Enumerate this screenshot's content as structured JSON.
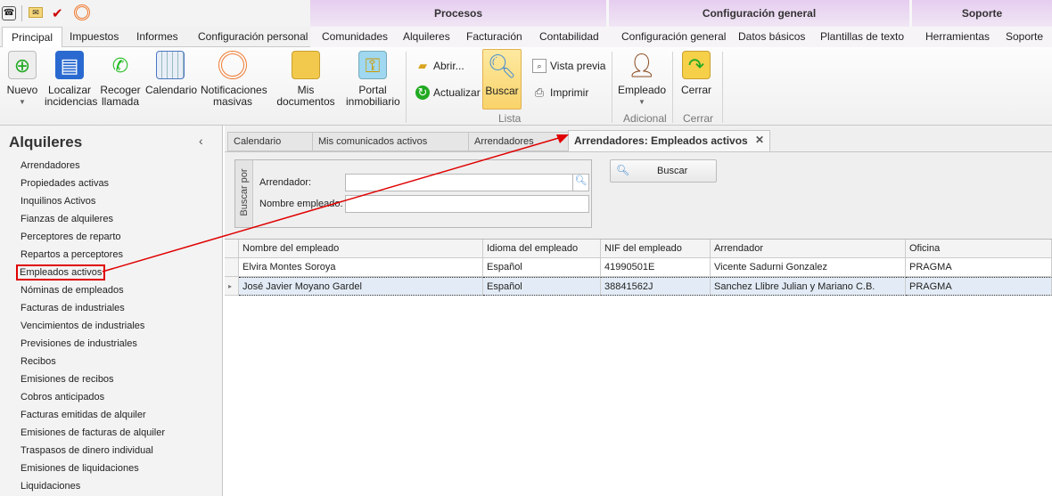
{
  "quick_access": {
    "icons": [
      "phone-app-icon",
      "mail-icon",
      "clipboard-check-icon",
      "broadcast-icon"
    ]
  },
  "context_groups": [
    "Procesos",
    "Configuración general",
    "Soporte"
  ],
  "ribbon_tabs": [
    "Principal",
    "Impuestos",
    "Informes",
    "Configuración personal",
    "Comunidades",
    "Alquileres",
    "Facturación",
    "Contabilidad",
    "Configuración general",
    "Datos básicos",
    "Plantillas de texto",
    "Herramientas",
    "Soporte"
  ],
  "ribbon": {
    "nuevo": "Nuevo",
    "localizar": "Localizar incidencias",
    "recoger": "Recoger llamada",
    "calendario": "Calendario",
    "notificaciones": "Notificaciones masivas",
    "documentos": "Mis documentos",
    "portal": "Portal inmobiliario",
    "abrir": "Abrir...",
    "actualizar": "Actualizar",
    "buscar": "Buscar",
    "vista_previa": "Vista previa",
    "imprimir": "Imprimir",
    "lista": "Lista",
    "empleado": "Empleado",
    "adicional": "Adicional",
    "cerrar": "Cerrar",
    "cerrar_group": "Cerrar"
  },
  "sidebar": {
    "title": "Alquileres",
    "items": [
      "Arrendadores",
      "Propiedades activas",
      "Inquilinos Activos",
      "Fianzas de alquileres",
      "Perceptores de reparto",
      "Repartos a perceptores",
      "Empleados activos",
      "Nóminas de empleados",
      "Facturas de industriales",
      "Vencimientos de industriales",
      "Previsiones de industriales",
      "Recibos",
      "Emisiones de recibos",
      "Cobros anticipados",
      "Facturas emitidas de alquiler",
      "Emisiones de facturas de alquiler",
      "Traspasos de dinero individual",
      "Emisiones de liquidaciones",
      "Liquidaciones"
    ],
    "selected": 6
  },
  "doc_tabs": [
    "Calendario",
    "Mis comunicados activos",
    "Arrendadores",
    "Arrendadores: Empleados activos"
  ],
  "filter": {
    "group_label": "Buscar por",
    "arrendador_label": "Arrendador:",
    "arrendador_value": "",
    "nombre_label": "Nombre empleado:",
    "nombre_value": "",
    "buscar": "Buscar"
  },
  "grid": {
    "columns": [
      "Nombre del empleado",
      "Idioma del empleado",
      "NIF del empleado",
      "Arrendador",
      "Oficina"
    ],
    "rows": [
      [
        "Elvira Montes Soroya",
        "Español",
        "41990501E",
        "Vicente Sadurni Gonzalez",
        "PRAGMA"
      ],
      [
        "José Javier Moyano Gardel",
        "Español",
        "38841562J",
        "Sanchez Llibre Julian y Mariano C.B.",
        "PRAGMA"
      ]
    ],
    "selected_row": 1
  },
  "annotation_color": "#e00000"
}
